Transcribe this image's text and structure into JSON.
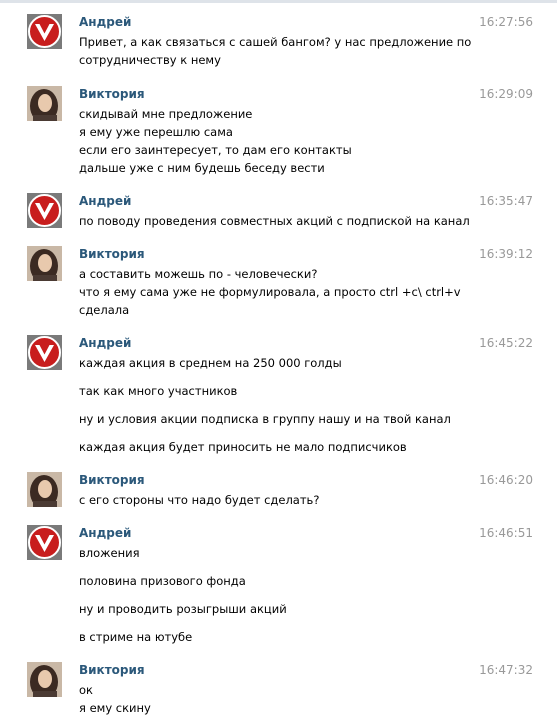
{
  "messages": [
    {
      "author": "Андрей",
      "avatar": "andrey-logo-avatar",
      "time": "16:27:56",
      "lines": [
        "Привет, а как связаться с сашей бангом? у нас предложение по",
        "сотрудничеству к нему"
      ]
    },
    {
      "author": "Виктория",
      "avatar": "viktoria-photo-avatar",
      "time": "16:29:09",
      "lines": [
        "скидывай мне предложение",
        "я ему уже перешлю сама",
        "если его заинтересует, то дам его контакты",
        "дальше уже с ним будешь беседу вести"
      ]
    },
    {
      "author": "Андрей",
      "avatar": "andrey-logo-avatar",
      "time": "16:35:47",
      "lines": [
        "по поводу проведения совместных акций с подпиской на канал"
      ]
    },
    {
      "author": "Виктория",
      "avatar": "viktoria-photo-avatar",
      "time": "16:39:12",
      "lines": [
        "а составить можешь по - человечески?",
        "что я ему сама уже не формулировала, а просто ctrl +c\\ ctrl+v",
        "сделала"
      ]
    },
    {
      "author": "Андрей",
      "avatar": "andrey-logo-avatar",
      "time": "16:45:22",
      "lines": [
        "каждая акция в среднем на 250 000 голды",
        "так как много участников",
        "ну и условия акции подписка в группу нашу и на твой канал",
        "каждая акция будет приносить не мало подписчиков"
      ]
    },
    {
      "author": "Виктория",
      "avatar": "viktoria-photo-avatar",
      "time": "16:46:20",
      "lines": [
        "с его стороны что надо будет сделать?"
      ]
    },
    {
      "author": "Андрей",
      "avatar": "andrey-logo-avatar",
      "time": "16:46:51",
      "lines": [
        "вложения",
        "половина призового фонда",
        "ну и проводить розыгрыши акций",
        "в стриме на ютубе"
      ]
    },
    {
      "author": "Виктория",
      "avatar": "viktoria-photo-avatar",
      "time": "16:47:32",
      "lines": [
        "ок",
        "я ему скину"
      ]
    }
  ],
  "colors": {
    "author": "#2b587a",
    "time": "#999999",
    "text": "#000000",
    "andrey_avatar_red": "#c81d1d",
    "viktoria_avatar_bg": "#c9b8a6"
  }
}
